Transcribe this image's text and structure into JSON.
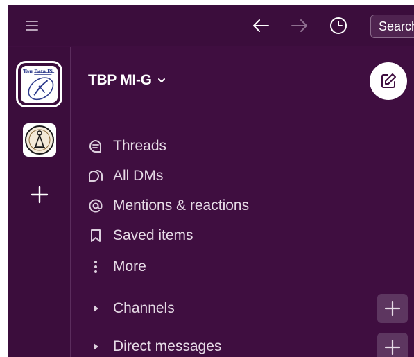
{
  "topbar": {
    "search_label": "Search",
    "icons": [
      "hamburger-icon",
      "arrow-left-icon",
      "arrow-right-icon",
      "history-clock-icon"
    ]
  },
  "rail": {
    "workspaces": [
      {
        "name": "Tau Beta Pi",
        "logo_text": "Tau Beta Pi",
        "icon": "tbp-logo",
        "active": true
      },
      {
        "name": "Bent logo",
        "icon": "bent-logo",
        "active": false
      }
    ],
    "add_icon": "plus-icon"
  },
  "sidebar": {
    "workspace_name": "TBP MI-G",
    "nav": [
      {
        "label": "Threads",
        "icon": "threads-icon"
      },
      {
        "label": "All DMs",
        "icon": "dms-icon"
      },
      {
        "label": "Mentions & reactions",
        "icon": "at-icon"
      },
      {
        "label": "Saved items",
        "icon": "bookmark-icon"
      },
      {
        "label": "More",
        "icon": "more-vertical-icon"
      }
    ],
    "sections": [
      {
        "label": "Channels"
      },
      {
        "label": "Direct messages"
      }
    ]
  },
  "colors": {
    "background": "#3f0e40",
    "rail": "#3b0d3c",
    "divider": "#5b2c5d",
    "text": "#e6dbe6",
    "plus_button": "#5d3660"
  }
}
